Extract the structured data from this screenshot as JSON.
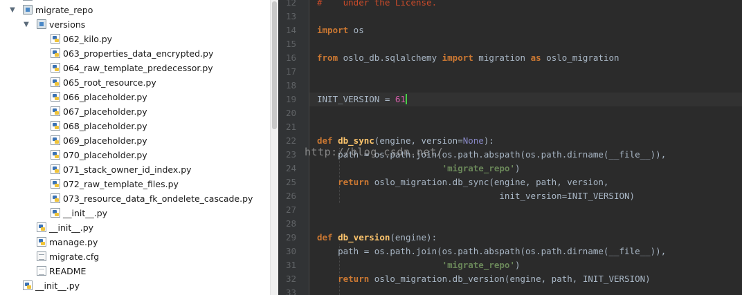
{
  "tree": {
    "items": [
      {
        "label": "migrate_repo",
        "icon": "folder-icon",
        "expanded": true
      },
      {
        "label": "versions",
        "icon": "folder-icon",
        "expanded": true
      },
      {
        "label": "062_kilo.py",
        "icon": "python-file-icon"
      },
      {
        "label": "063_properties_data_encrypted.py",
        "icon": "python-file-icon"
      },
      {
        "label": "064_raw_template_predecessor.py",
        "icon": "python-file-icon"
      },
      {
        "label": "065_root_resource.py",
        "icon": "python-file-icon"
      },
      {
        "label": "066_placeholder.py",
        "icon": "python-file-icon"
      },
      {
        "label": "067_placeholder.py",
        "icon": "python-file-icon"
      },
      {
        "label": "068_placeholder.py",
        "icon": "python-file-icon"
      },
      {
        "label": "069_placeholder.py",
        "icon": "python-file-icon"
      },
      {
        "label": "070_placeholder.py",
        "icon": "python-file-icon"
      },
      {
        "label": "071_stack_owner_id_index.py",
        "icon": "python-file-icon"
      },
      {
        "label": "072_raw_template_files.py",
        "icon": "python-file-icon"
      },
      {
        "label": "073_resource_data_fk_ondelete_cascade.py",
        "icon": "python-file-icon"
      },
      {
        "label": "__init__.py",
        "icon": "python-file-icon"
      },
      {
        "label": "__init__.py",
        "icon": "python-file-icon"
      },
      {
        "label": "manage.py",
        "icon": "python-file-icon"
      },
      {
        "label": "migrate.cfg",
        "icon": "config-file-icon"
      },
      {
        "label": "README",
        "icon": "text-file-icon"
      },
      {
        "label": "__init__.py",
        "icon": "python-file-icon"
      }
    ]
  },
  "editor": {
    "line_numbers": [
      "12",
      "13",
      "14",
      "15",
      "16",
      "17",
      "18",
      "19",
      "20",
      "21",
      "22",
      "23",
      "24",
      "25",
      "26",
      "27",
      "28",
      "29",
      "30",
      "31",
      "32",
      "33"
    ],
    "current_line": "19",
    "lines": {
      "l12": {
        "comment": "#    under the License."
      },
      "l14": {
        "kw": "import",
        "rest": " os"
      },
      "l16": {
        "kw1": "from",
        "mid1": " oslo_db.sqlalchemy ",
        "kw2": "import",
        "mid2": " migration ",
        "kw3": "as",
        "rest": " oslo_migration"
      },
      "l19": {
        "name": "INIT_VERSION = ",
        "value": "61"
      },
      "l22": {
        "kw": "def",
        "sp": " ",
        "fn": "db_sync",
        "args1": "(engine, version=",
        "none": "None",
        "args2": "):"
      },
      "l23": {
        "text": "    path = os.path.join(os.path.abspath(os.path.dirname(__file__)),"
      },
      "l24": {
        "indent": "                        ",
        "str": "'migrate_repo'",
        "close": ")"
      },
      "l25": {
        "indent": "    ",
        "kw": "return",
        "rest": " oslo_migration.db_sync(engine, path, version,"
      },
      "l26": {
        "text": "                                   init_version=INIT_VERSION)"
      },
      "l29": {
        "kw": "def",
        "sp": " ",
        "fn": "db_version",
        "args": "(engine):"
      },
      "l30": {
        "text": "    path = os.path.join(os.path.abspath(os.path.dirname(__file__)),"
      },
      "l31": {
        "indent": "                        ",
        "str": "'migrate_repo'",
        "close": ")"
      },
      "l32": {
        "indent": "    ",
        "kw": "return",
        "rest": " oslo_migration.db_version(engine, path, INIT_VERSION)"
      }
    }
  },
  "watermark": "http://blog.csdn.net/",
  "colors": {
    "keyword": "#cc7832",
    "function": "#ffc66d",
    "string": "#6a8759",
    "number": "#d45ea9",
    "comment": "#cc4b2a",
    "builtin_const": "#8888c6",
    "caret": "#48d048"
  }
}
